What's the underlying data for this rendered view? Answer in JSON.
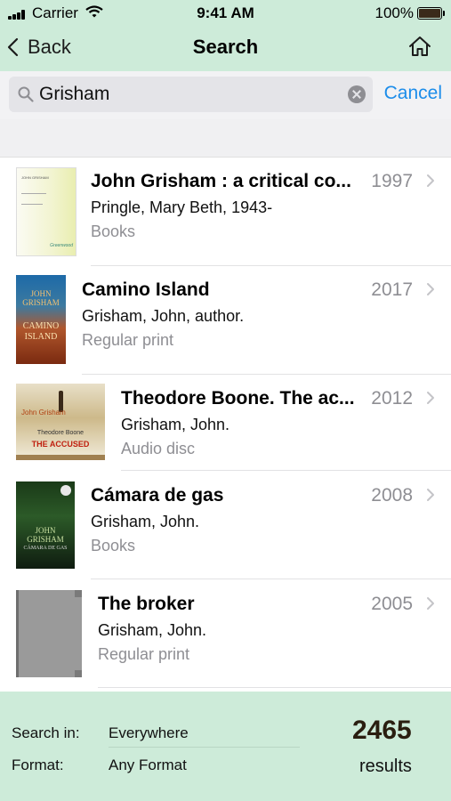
{
  "status": {
    "carrier": "Carrier",
    "time": "9:41 AM",
    "battery": "100%"
  },
  "nav": {
    "back_label": "Back",
    "title": "Search",
    "home_icon": "home-icon"
  },
  "search": {
    "value": "Grisham",
    "cancel_label": "Cancel"
  },
  "results": [
    {
      "title": "John Grisham : a critical co...",
      "author": "Pringle, Mary Beth, 1943-",
      "format": "Books",
      "year": "1997",
      "cover": {
        "text_line1": "JOHN GRISHAM",
        "publisher": "Greenwood"
      }
    },
    {
      "title": "Camino Island",
      "author": "Grisham, John, author.",
      "format": "Regular print",
      "year": "2017",
      "cover": {
        "author_text": "JOHN GRISHAM",
        "title_text": "CAMINO ISLAND"
      }
    },
    {
      "title": "Theodore Boone. The ac...",
      "author": "Grisham, John.",
      "format": "Audio disc",
      "year": "2012",
      "cover": {
        "author_text": "John Grisham",
        "series_text": "Theodore Boone",
        "title_text": "THE ACCUSED"
      }
    },
    {
      "title": "Cámara de gas",
      "author": "Grisham, John.",
      "format": "Books",
      "year": "2008",
      "cover": {
        "author_text": "JOHN GRISHAM",
        "title_text": "CÁMARA DE GAS"
      }
    },
    {
      "title": "The broker",
      "author": "Grisham, John.",
      "format": "Regular print",
      "year": "2005"
    }
  ],
  "footer": {
    "search_in_label": "Search in:",
    "search_in_value": "Everywhere",
    "format_label": "Format:",
    "format_value": "Any Format",
    "count": "2465",
    "count_label": "results"
  },
  "colors": {
    "header_bg": "#cdebd9",
    "accent": "#1c8dea",
    "secondary_text": "#8e8e93"
  }
}
